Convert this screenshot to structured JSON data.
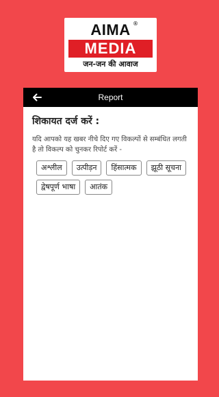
{
  "logo": {
    "brand": "AIMA",
    "reg_mark": "®",
    "media": "MEDIA",
    "tagline": "जन-जन की आवाज"
  },
  "header": {
    "back_icon": "arrow-left-icon",
    "title": "Report"
  },
  "report": {
    "heading": "शिकायत दर्ज करें :",
    "description": "यदि आपको यह खबर नीचे दिए गए विकल्पों से सम्बंधित लगती है तो विकल्प को चुनकर रिपोर्ट करें -",
    "options": [
      {
        "label": "अश्लील"
      },
      {
        "label": "उत्पीड़न"
      },
      {
        "label": "हिंसात्मक"
      },
      {
        "label": "झूठी सूचना"
      },
      {
        "label": "द्वेषपूर्ण भाषा"
      },
      {
        "label": "आतंक"
      }
    ]
  },
  "colors": {
    "background": "#f2474b",
    "brand_red": "#e01f26",
    "header_bg": "#000000"
  }
}
